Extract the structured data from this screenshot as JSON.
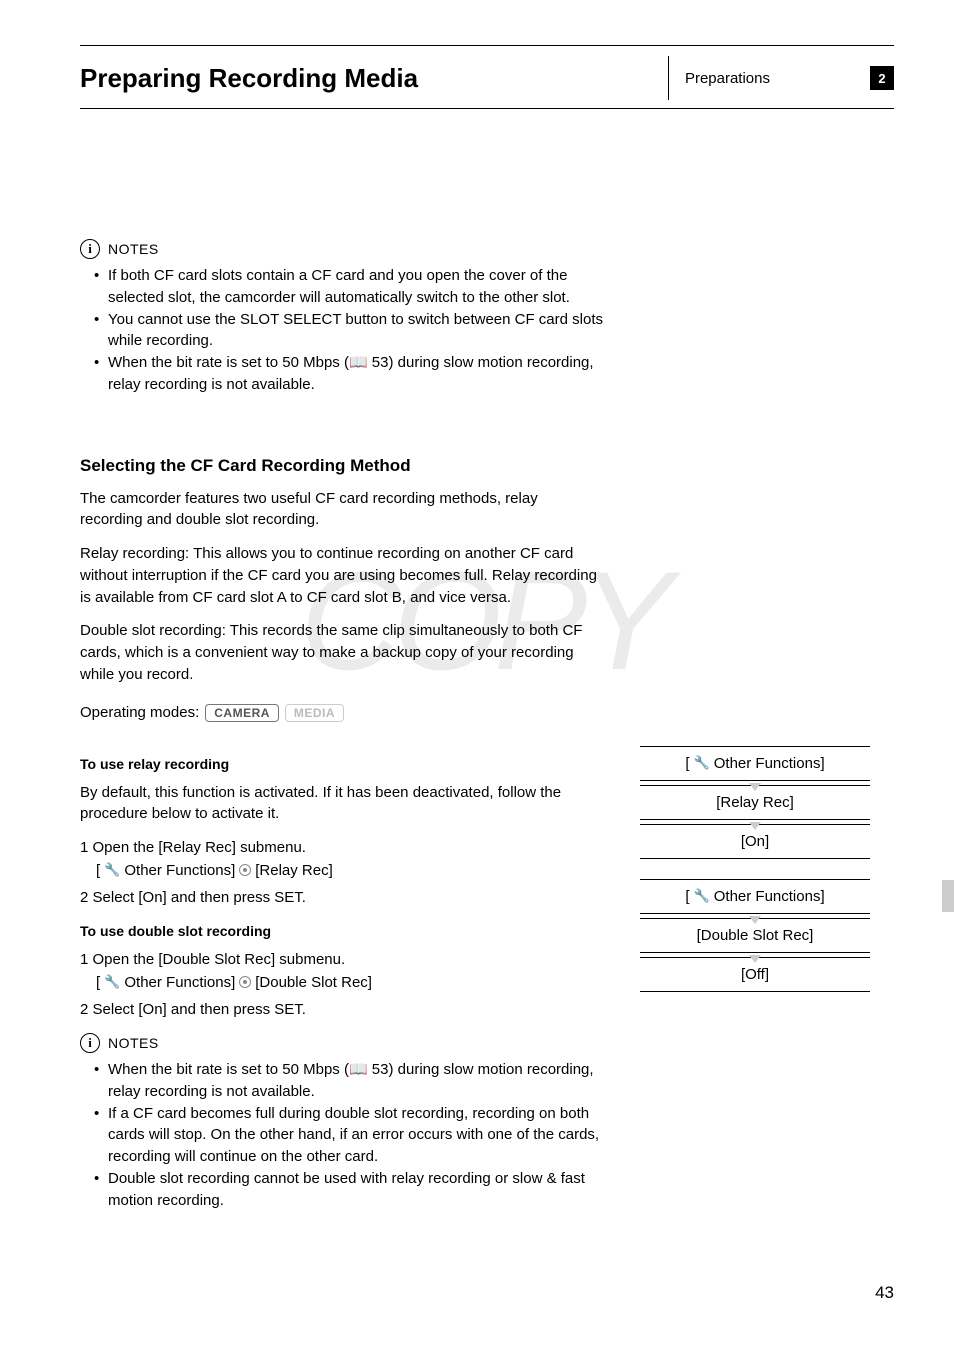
{
  "header": {
    "title": "Preparing Recording Media",
    "breadcrumb": "Preparations",
    "chapter": "2"
  },
  "notes1": {
    "label": "NOTES",
    "items": [
      "If both CF card slots contain a CF card and you open the cover of the selected slot, the camcorder will automatically switch to the other slot.",
      "You cannot use the SLOT SELECT button to switch between CF card slots while recording.",
      "When the bit rate is set to 50 Mbps (📖 53) during slow motion recording, relay recording is not available."
    ]
  },
  "section": {
    "heading": "Selecting the CF Card Recording Method",
    "p1": "The camcorder features two useful CF card recording methods, relay recording and double slot recording.",
    "p2": "Relay recording: This allows you to continue recording on another CF card without interruption if the CF card you are using becomes full. Relay recording is available from CF card slot A to CF card slot B, and vice versa.",
    "p3": "Double slot recording: This records the same clip simultaneously to both CF cards, which is a convenient way to make a backup copy of your recording while you record.",
    "operating_label": "Operating modes:",
    "mode_camera": "CAMERA",
    "mode_media": "MEDIA"
  },
  "relay": {
    "heading": "To use relay recording",
    "intro": "By default, this function is activated. If it has been deactivated, follow the procedure below to activate it.",
    "step1": "1 Open the [Relay Rec] submenu.",
    "step1_detail_a": "Other Functions]",
    "step1_detail_b": "[Relay Rec]",
    "step2": "2 Select [On] and then press SET."
  },
  "double": {
    "heading": "To use double slot recording",
    "step1": "1 Open the [Double Slot Rec] submenu.",
    "step1_detail_a": "Other Functions]",
    "step1_detail_b": "[Double Slot Rec]",
    "step2": "2 Select [On] and then press SET."
  },
  "notes2": {
    "label": "NOTES",
    "items": [
      "When the bit rate is set to 50 Mbps (📖 53) during slow motion recording, relay recording is not available.",
      "If a CF card becomes full during double slot recording, recording on both cards will stop. On the other hand, if an error occurs with one of the cards, recording will continue on the other card.",
      "Double slot recording cannot be used with relay recording or slow & fast motion recording."
    ]
  },
  "menu1": {
    "row1": "Other Functions]",
    "row2": "[Relay Rec]",
    "row3": "[On]"
  },
  "menu2": {
    "row1": "Other Functions]",
    "row2": "[Double Slot Rec]",
    "row3": "[Off]"
  },
  "page_number": "43",
  "watermark": "COPY"
}
